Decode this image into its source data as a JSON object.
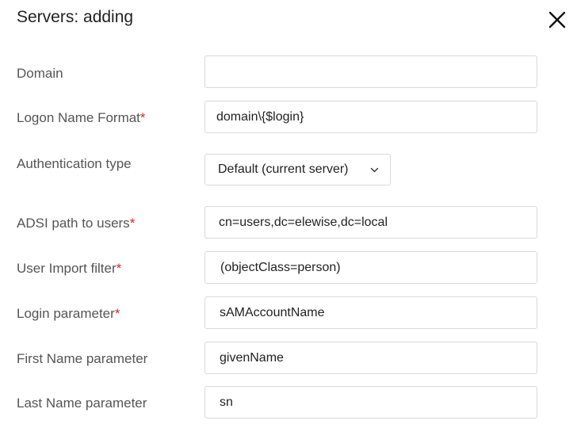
{
  "dialog": {
    "title": "Servers: adding"
  },
  "fields": {
    "domain": {
      "label": "Domain",
      "value": ""
    },
    "logon_name_format": {
      "label": "Logon Name Format",
      "required": "*",
      "value": "domain\\{$login}"
    },
    "authentication_type": {
      "label": "Authentication type",
      "value": "Default (current server)"
    },
    "adsi_path": {
      "label": "ADSI path to users",
      "required": "*",
      "value": "cn=users,dc=elewise,dc=local"
    },
    "user_import_filter": {
      "label": "User Import filter",
      "required": "*",
      "value": "(objectClass=person)"
    },
    "login_parameter": {
      "label": "Login parameter",
      "required": "*",
      "value": "sAMAccountName"
    },
    "first_name_parameter": {
      "label": "First Name parameter",
      "value": "givenName"
    },
    "last_name_parameter": {
      "label": "Last Name parameter",
      "value": "sn"
    }
  },
  "icons": {
    "close": "close-icon",
    "dropdown": "chevron-down-icon"
  },
  "colors": {
    "required_marker": "#e02424",
    "field_border": "#d9d9d9"
  }
}
